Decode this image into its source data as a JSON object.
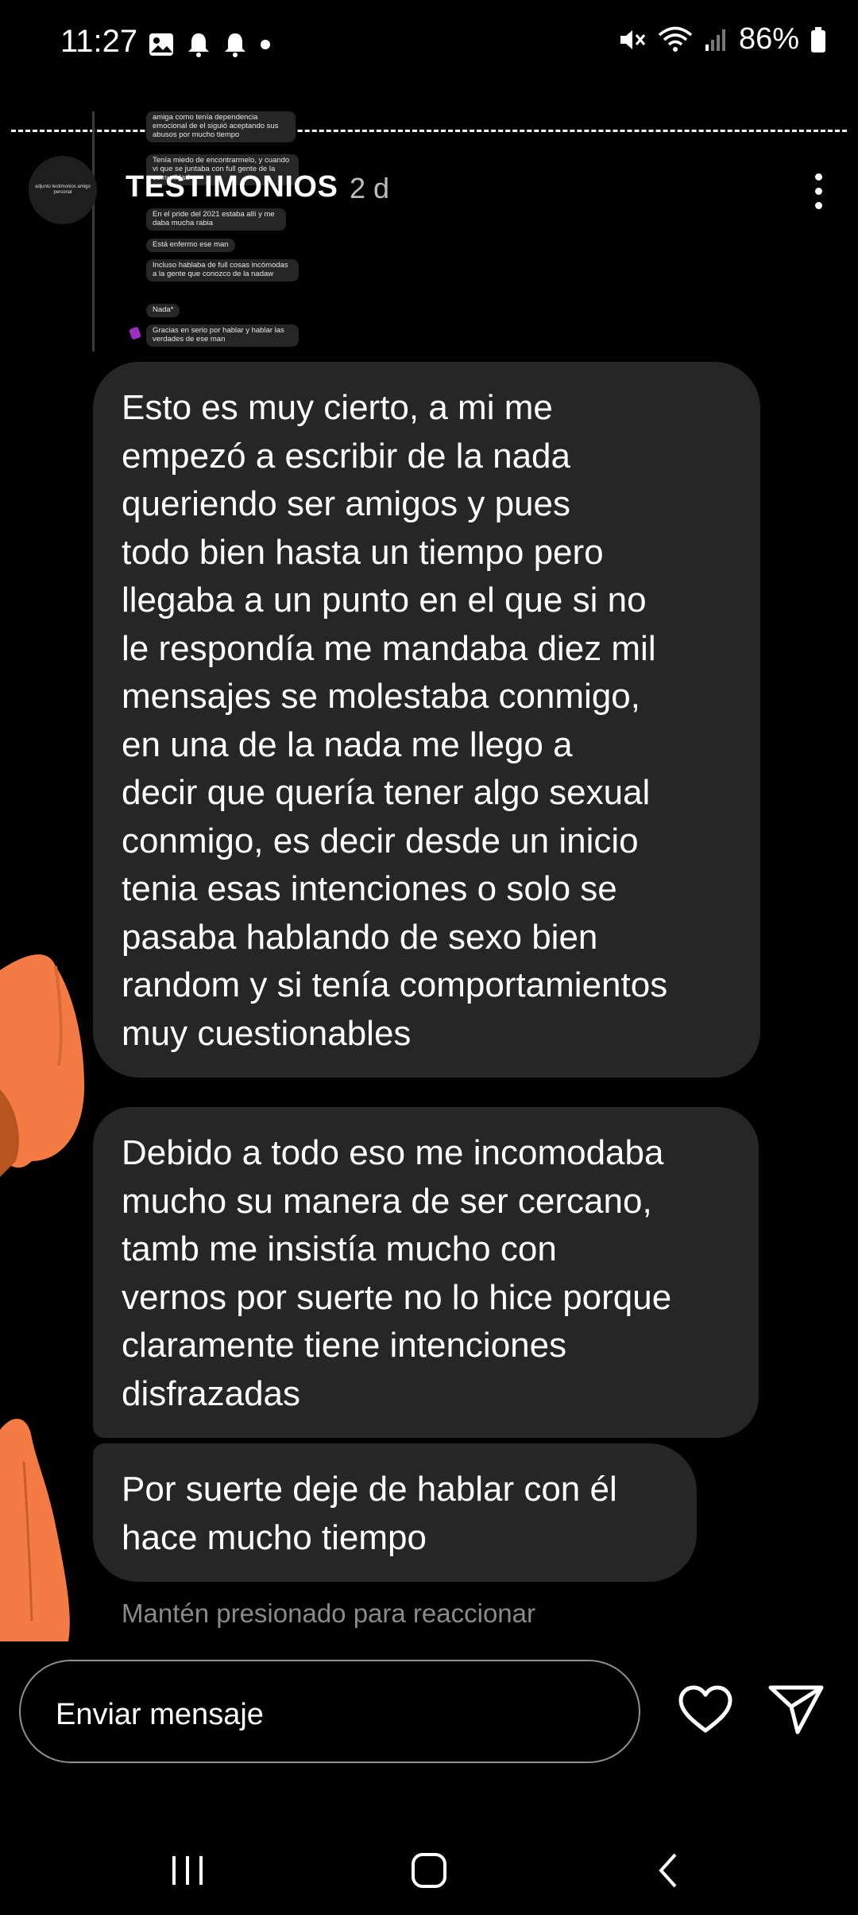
{
  "status_bar": {
    "time": "11:27",
    "battery": "86%",
    "left_icons": [
      "gallery-icon",
      "bell-icon",
      "bell-icon",
      "dot-icon"
    ],
    "right_icons": [
      "mute-icon",
      "wifi-icon",
      "signal-icon",
      "battery-icon"
    ]
  },
  "story": {
    "account_name": "TESTIMONIOS",
    "posted_ago": "2 d",
    "avatar_text": "adjunto testimonios amigo personal",
    "preview_messages": [
      "amiga como tenía dependencia emocional de el siguió aceptando sus abusos por mucho tiempo",
      "Tenía miedo de encontrarmelo, y cuando vi que se juntaba con full gente de la comunidad",
      "En el pride del 2021 estaba allí y me daba mucha rabia",
      "Está enfermo ese man",
      "Incluso hablaba de full cosas incómodas a la gente que conozco de la nadaw",
      "Nada*",
      "Gracias en serio por hablar y hablar las verdades de ese man"
    ]
  },
  "messages": [
    {
      "lines": [
        "Esto es muy cierto, a mi me",
        "empezó a escribir de la nada",
        "queriendo ser amigos y pues",
        "todo bien hasta un tiempo pero",
        "llegaba a un punto en el que si no",
        "le respondía me mandaba diez mil",
        "mensajes se molestaba conmigo,",
        "en una de la nada me llego a",
        "decir que quería tener algo sexual",
        "conmigo, es decir desde un inicio",
        "tenia esas intenciones o solo se",
        "pasaba hablando de sexo bien",
        "random y si tenía comportamientos",
        "muy cuestionables"
      ]
    },
    {
      "lines": [
        "Debido a todo eso me incomodaba",
        "mucho su manera de ser cercano,",
        "tamb me insistía mucho con",
        "vernos por suerte no lo hice porque",
        "claramente tiene intenciones",
        "disfrazadas"
      ]
    },
    {
      "lines": [
        "Por suerte deje de hablar con él",
        "hace mucho tiempo"
      ]
    }
  ],
  "react_hint": "Mantén presionado para reaccionar",
  "composer": {
    "placeholder": "Enviar mensaje"
  },
  "colors": {
    "background": "#000000",
    "bubble": "#262626",
    "scribble": "#f47c44"
  }
}
